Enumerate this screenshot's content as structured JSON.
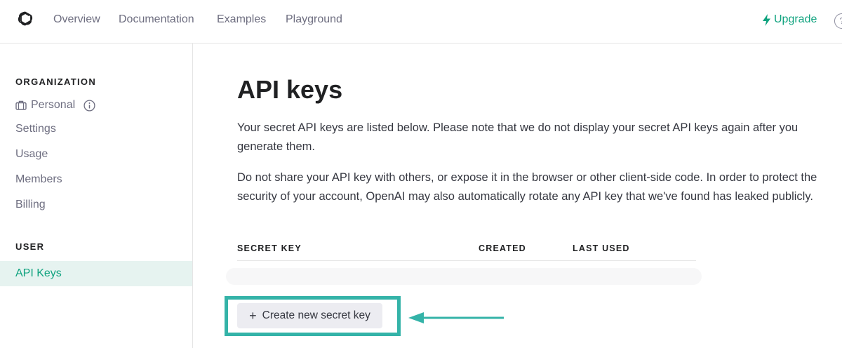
{
  "nav": {
    "items": [
      "Overview",
      "Documentation",
      "Examples",
      "Playground"
    ],
    "upgrade_label": "Upgrade",
    "help_glyph": "?"
  },
  "sidebar": {
    "organization_heading": "ORGANIZATION",
    "org_name": "Personal",
    "org_items": [
      "Settings",
      "Usage",
      "Members",
      "Billing"
    ],
    "user_heading": "USER",
    "user_items": [
      "API Keys"
    ]
  },
  "main": {
    "title": "API keys",
    "para1": "Your secret API keys are listed below. Please note that we do not display your secret API keys again after you generate them.",
    "para2": "Do not share your API key with others, or expose it in the browser or other client-side code. In order to protect the security of your account, OpenAI may also automatically rotate any API key that we've found has leaked publicly.",
    "table": {
      "columns": [
        "SECRET KEY",
        "CREATED",
        "LAST USED"
      ],
      "rows": []
    },
    "create_button_label": "Create new secret key"
  },
  "colors": {
    "accent": "#10a37f",
    "highlight": "#34b3a8",
    "active_bg": "#e6f3f0"
  },
  "icons": [
    "openai-logo-icon",
    "bolt-icon",
    "help-icon",
    "briefcase-icon",
    "info-icon",
    "plus-icon",
    "arrow-left-icon"
  ]
}
